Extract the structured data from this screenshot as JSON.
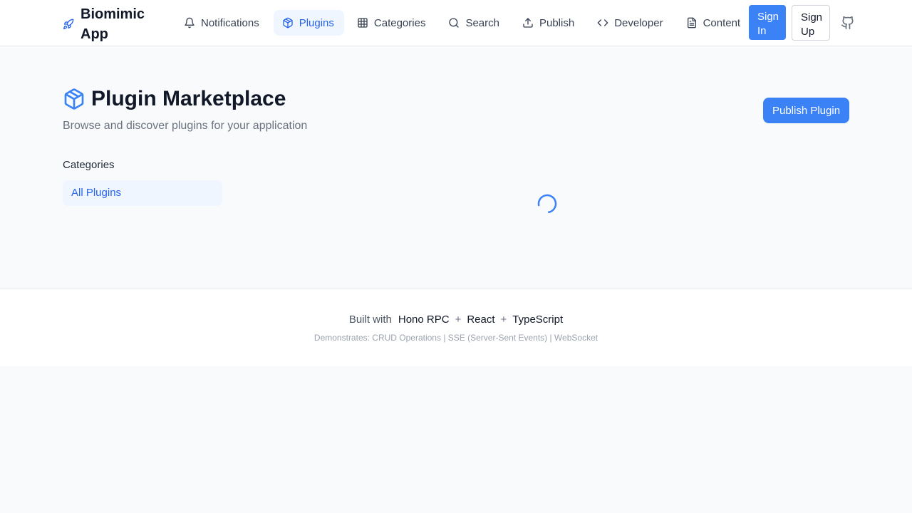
{
  "header": {
    "brand": "Biomimic App",
    "brand_icon": "rocket-icon",
    "nav": [
      {
        "label": "Notifications",
        "icon": "bell-icon",
        "active": false
      },
      {
        "label": "Plugins",
        "icon": "package-icon",
        "active": true
      },
      {
        "label": "Categories",
        "icon": "grid-icon",
        "active": false
      },
      {
        "label": "Search",
        "icon": "search-icon",
        "active": false
      },
      {
        "label": "Publish",
        "icon": "upload-icon",
        "active": false
      },
      {
        "label": "Developer",
        "icon": "code-icon",
        "active": false
      },
      {
        "label": "Content",
        "icon": "file-text-icon",
        "active": false
      }
    ],
    "sign_in": "Sign In",
    "sign_up": "Sign Up",
    "github_icon": "github-icon"
  },
  "main": {
    "title": "Plugin Marketplace",
    "title_icon": "package-icon",
    "subtitle": "Browse and discover plugins for your application",
    "publish_button": "Publish Plugin",
    "categories_heading": "Categories",
    "categories": [
      "All Plugins"
    ],
    "loading_icon": "spinner-icon"
  },
  "footer": {
    "built_with": "Built with",
    "tech": [
      "Hono RPC",
      "React",
      "TypeScript"
    ],
    "separator": "+",
    "demonstrates": "Demonstrates: CRUD Operations | SSE (Server-Sent Events) | WebSocket"
  },
  "colors": {
    "accent": "#3b82f6",
    "accent_text": "#2563eb",
    "active_bg": "#eff6ff",
    "page_bg": "#f8fafc"
  }
}
